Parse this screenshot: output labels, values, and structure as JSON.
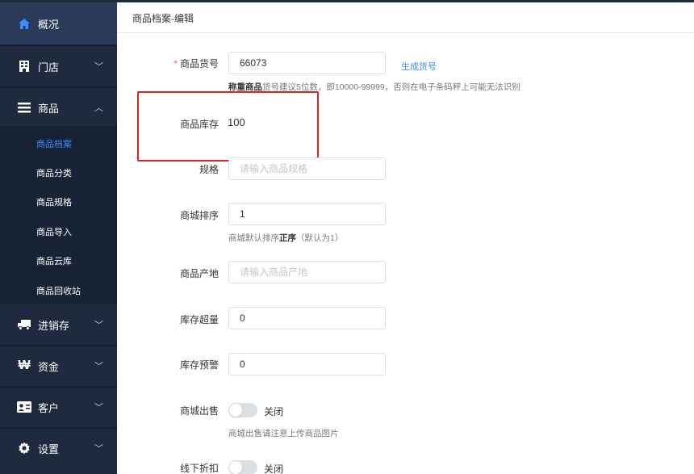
{
  "breadcrumb": "商品档案-编辑",
  "sidebar": {
    "items": [
      {
        "label": "概况",
        "icon": "home-icon"
      },
      {
        "label": "门店",
        "icon": "store-icon"
      },
      {
        "label": "商品",
        "icon": "list-icon"
      },
      {
        "label": "进销存",
        "icon": "truck-icon"
      },
      {
        "label": "资金",
        "icon": "currency-icon"
      },
      {
        "label": "客户",
        "icon": "contact-card-icon"
      },
      {
        "label": "设置",
        "icon": "gear-icon"
      }
    ],
    "submenu": [
      "商品档案",
      "商品分类",
      "商品规格",
      "商品导入",
      "商品云库",
      "商品回收站"
    ],
    "active_submenu": "商品档案"
  },
  "form": {
    "sku": {
      "label": "商品货号",
      "value": "66073",
      "link": "生成货号",
      "hint_bold": "称重商品",
      "hint": "货号建议5位数，即10000-99999，否则在电子条码秤上可能无法识别"
    },
    "stock": {
      "label": "商品库存",
      "value": "100"
    },
    "spec": {
      "label": "规格",
      "placeholder": "请输入商品规格"
    },
    "sort": {
      "label": "商城排序",
      "value": "1",
      "hint_pre": "商城默认排序",
      "hint_bold": "正序",
      "hint_post": "（默认为1）"
    },
    "origin": {
      "label": "商品产地",
      "placeholder": "请输入商品产地"
    },
    "overstock": {
      "label": "库存超量",
      "value": "0"
    },
    "warning": {
      "label": "库存预警",
      "value": "0"
    },
    "mall_sale": {
      "label": "商城出售",
      "state": "关闭",
      "hint": "商城出售请注意上传商品图片"
    },
    "offline_discount": {
      "label": "线下折扣",
      "state": "关闭"
    }
  },
  "colors": {
    "sidebar": "#1f2a3f",
    "accent": "#3b8cff",
    "highlight_box": "#e02222"
  }
}
